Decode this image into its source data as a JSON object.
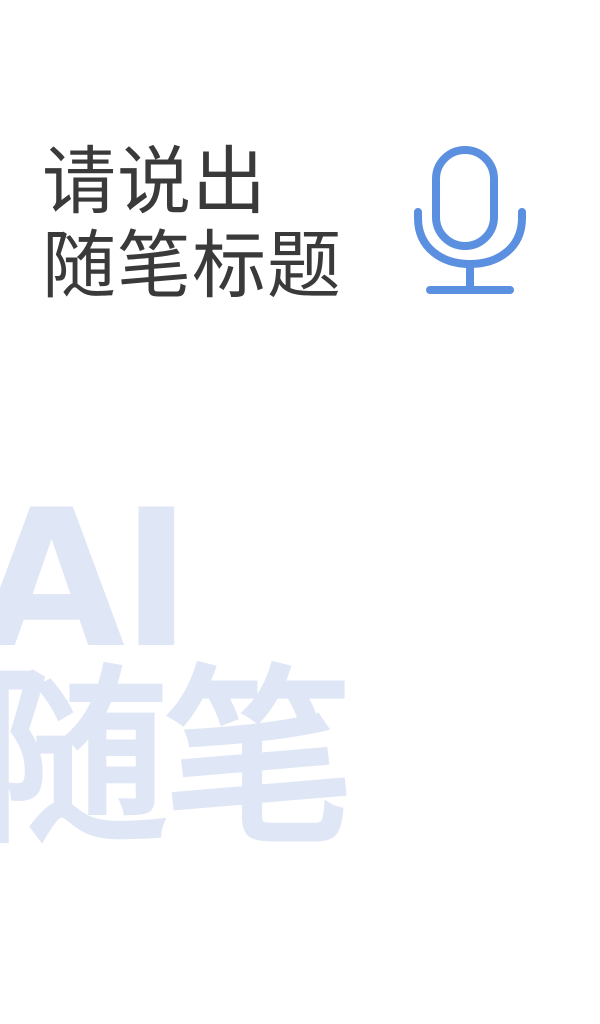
{
  "prompt": {
    "line1": "请说出",
    "line2": "随笔标题"
  },
  "mic_button": {
    "icon": "microphone-icon",
    "color": "#5b8fdf"
  },
  "watermark": {
    "line1": "AI",
    "line2": "随笔",
    "color": "#dfe6f6"
  }
}
